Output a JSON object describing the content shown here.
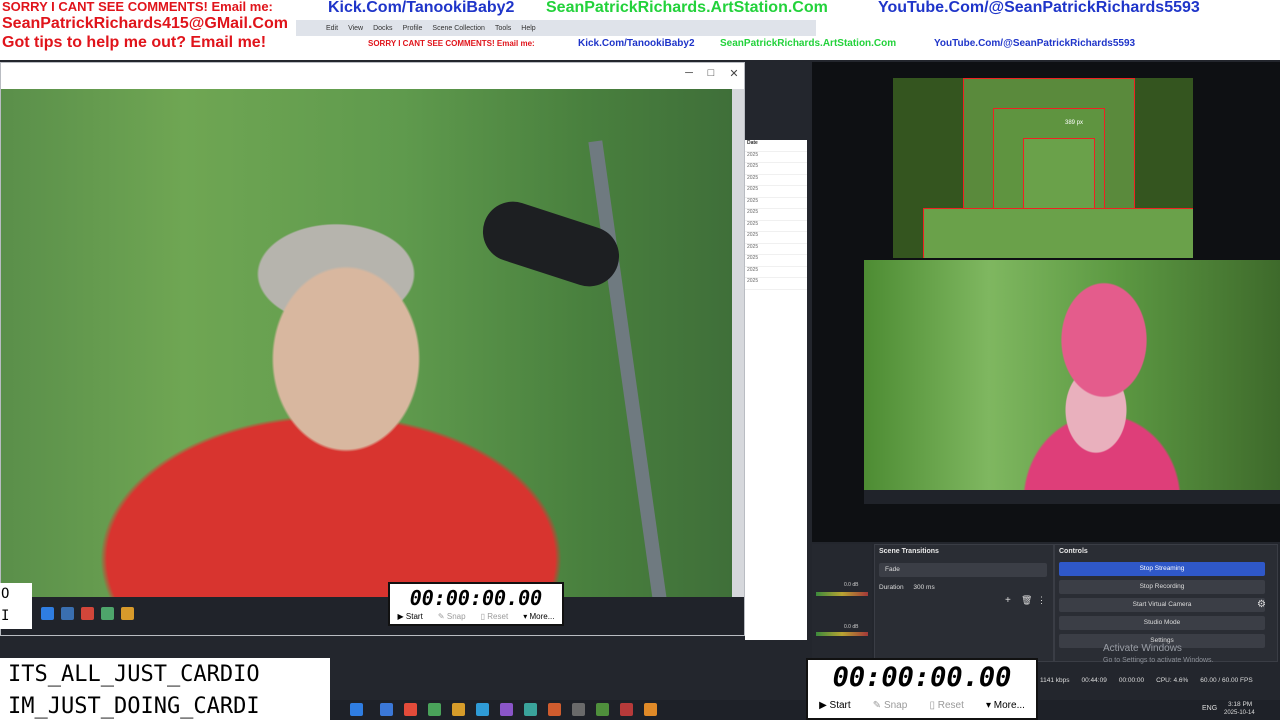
{
  "overlay": {
    "sorry_text": "SORRY I CANT SEE COMMENTS! Email me:",
    "kick_url": "Kick.Com/TanookiBaby2",
    "artstation_url": "SeanPatrickRichards.ArtStation.Com",
    "youtube_url": "YouTube.Com/@SeanPatrickRichards5593",
    "email": "SeanPatrickRichards415@GMail.Com",
    "tips_text": "Got tips to help me out? Email me!"
  },
  "obs_menu": [
    "Edit",
    "View",
    "Docks",
    "Profile",
    "Scene Collection",
    "Tools",
    "Help"
  ],
  "file_list": {
    "header": "Date",
    "year_label": "2025"
  },
  "mini_preview": {
    "label": "389 px"
  },
  "scene_transitions": {
    "title": "Scene Transitions",
    "transition": "Fade",
    "duration_label": "Duration",
    "duration_value": "300 ms"
  },
  "controls": {
    "title": "Controls",
    "buttons": [
      "Stop Streaming",
      "Stop Recording",
      "Start Virtual Camera",
      "Studio Mode",
      "Settings"
    ]
  },
  "cardio": {
    "line1": "ITS_ALL_JUST_CARDIO",
    "line2": "IM_JUST_DOING_CARDI"
  },
  "left_edge": {
    "line1": "O",
    "line2": "I"
  },
  "timer_small": {
    "digits": "00:00:00.00",
    "start": "Start",
    "snap": "Snap",
    "reset": "Reset",
    "more": "More..."
  },
  "timer_large": {
    "digits": "00:00:00.00",
    "start": "Start",
    "snap": "Snap",
    "reset": "Reset",
    "more": "More..."
  },
  "status": {
    "bitrate": "1141 kbps",
    "elapsed": "00:44:09",
    "rec_time": "00:00:00",
    "cpu": "CPU: 4.6%",
    "fps": "60.00 / 60.00 FPS",
    "lang": "ENG",
    "time": "3:18 PM",
    "date": "2025-10-14"
  },
  "watermark": {
    "title": "Activate Windows",
    "subtitle": "Go to Settings to activate Windows."
  },
  "audio": {
    "db1": "0.0 dB",
    "db2": "0.0 dB"
  }
}
